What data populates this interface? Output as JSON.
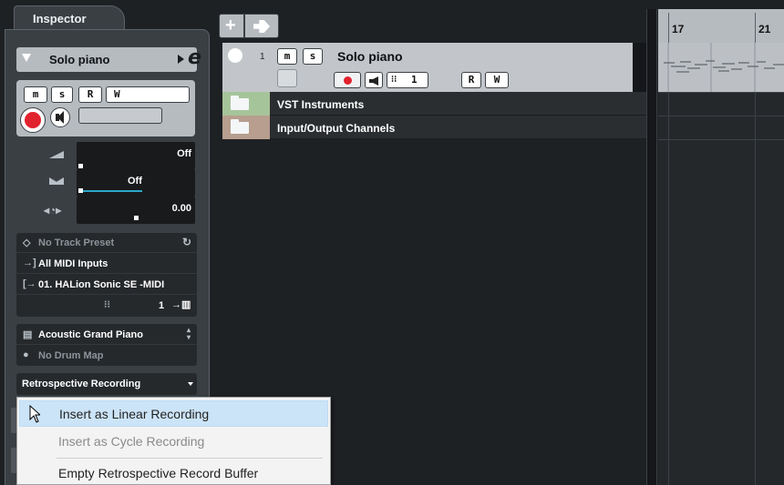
{
  "inspector": {
    "tab_label": "Inspector",
    "track_name": "Solo piano",
    "buttons": {
      "mute": "m",
      "solo": "s",
      "read": "R",
      "write": "W"
    },
    "volume": {
      "value": "Off",
      "level": 0.0
    },
    "pan": {
      "value": "Off",
      "level": 0.0
    },
    "delay": {
      "value": "0.00",
      "level": 0.5
    },
    "presets": {
      "track_preset": "No Track Preset",
      "midi_input": "All MIDI Inputs",
      "midi_output": "01. HALion Sonic SE -MIDI",
      "channel": "1"
    },
    "program": "Acoustic Grand Piano",
    "drum_map": "No Drum Map",
    "retro_recording": "Retrospective Recording"
  },
  "project": {
    "track": {
      "number": "1",
      "name": "Solo piano",
      "buttons": {
        "mute": "m",
        "solo": "s",
        "read": "R",
        "write": "W"
      },
      "channel": "1"
    },
    "folders": [
      {
        "label": "VST Instruments",
        "color": "#a6c49a"
      },
      {
        "label": "Input/Output Channels",
        "color": "#b79e8e"
      }
    ],
    "ruler": {
      "bars": [
        "17",
        "21"
      ]
    }
  },
  "context_menu": {
    "items": [
      {
        "label": "Insert as Linear Recording",
        "state": "highlighted"
      },
      {
        "label": "Insert as Cycle Recording",
        "state": "disabled"
      },
      {
        "label": "Empty Retrospective Record Buffer",
        "state": "normal"
      }
    ]
  },
  "colors": {
    "record_red": "#e1232e",
    "highlight": "#cce4f7",
    "track_bg": "#c2c6ca"
  }
}
